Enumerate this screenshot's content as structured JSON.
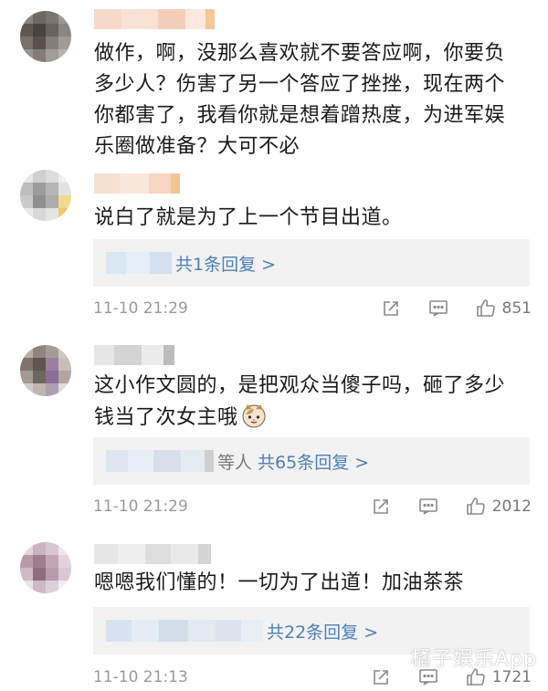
{
  "comments": [
    {
      "text": "做作，啊，没那么喜欢就不要答应啊，你要负多少人？伤害了另一个答应了挫挫，现在两个你都害了，我看你就是想着蹭热度，为进军娱乐圈做准备？大可不必"
    },
    {
      "text": "说白了就是为了上一个节目出道。",
      "reply_summary": "共1条回复 >",
      "time": "11-10 21:29",
      "likes": "851"
    },
    {
      "text": "这小作文圆的，是把观众当傻子吗，砸了多少钱当了次女主哦",
      "reply_prefix": "等人",
      "reply_summary": "共65条回复 >",
      "time": "11-10 21:29",
      "likes": "2012"
    },
    {
      "text": "嗯嗯我们懂的！一切为了出道！加油茶茶",
      "reply_summary": "共22条回复 >",
      "time": "11-10 21:13",
      "likes": "1721"
    }
  ],
  "watermark": "橘子娱乐App",
  "icons": {
    "share": "share-icon",
    "comment": "comment-icon",
    "like": "thumbs-up-icon",
    "emoji": "cat-face-emoji"
  },
  "colors": {
    "link": "#4d7fb8",
    "meta": "#9a9a9a",
    "reply_bg": "#f2f2f2"
  }
}
